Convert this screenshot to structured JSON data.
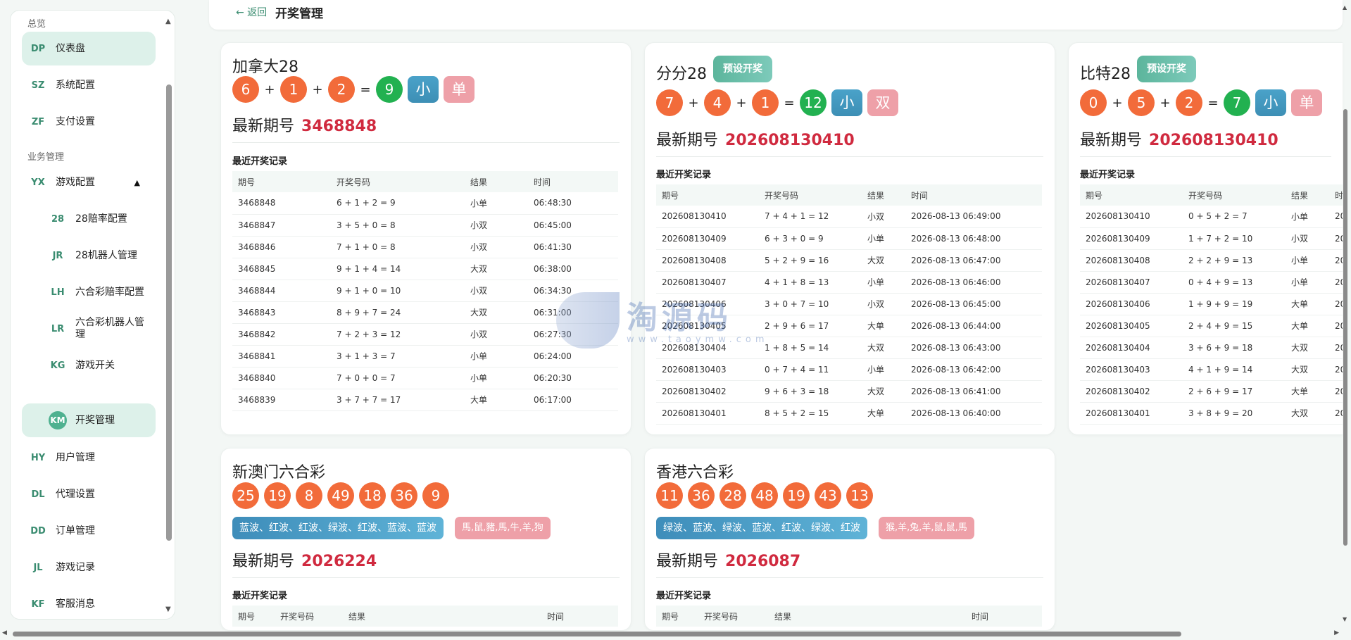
{
  "sidebar": {
    "sections": [
      "总览",
      "业务管理"
    ],
    "items": [
      {
        "abbr": "DP",
        "label": "仪表盘"
      },
      {
        "abbr": "SZ",
        "label": "系统配置"
      },
      {
        "abbr": "ZF",
        "label": "支付设置"
      },
      {
        "abbr": "YX",
        "label": "游戏配置"
      },
      {
        "abbr": "28",
        "label": "28赔率配置"
      },
      {
        "abbr": "JR",
        "label": "28机器人管理"
      },
      {
        "abbr": "LH",
        "label": "六合彩赔率配置"
      },
      {
        "abbr": "LR",
        "label": "六合彩机器人管\n理"
      },
      {
        "abbr": "KG",
        "label": "游戏开关"
      },
      {
        "abbr": "KM",
        "label": "开奖管理"
      },
      {
        "abbr": "HY",
        "label": "用户管理"
      },
      {
        "abbr": "DL",
        "label": "代理设置"
      },
      {
        "abbr": "DD",
        "label": "订单管理"
      },
      {
        "abbr": "JL",
        "label": "游戏记录"
      },
      {
        "abbr": "KF",
        "label": "客服消息"
      }
    ],
    "caret": "▲"
  },
  "header": {
    "back": "← 返回",
    "title": "开奖管理"
  },
  "common": {
    "preset": "预设开奖",
    "latest_label": "最新期号",
    "records_title": "最近开奖记录",
    "cols": [
      "期号",
      "开奖号码",
      "结果",
      "时间"
    ],
    "plus": "+",
    "eq": "="
  },
  "cards": {
    "ca28": {
      "name": "加拿大28",
      "balls": [
        "6",
        "1",
        "2"
      ],
      "sum": "9",
      "size": "小",
      "parity": "单",
      "latest": "3468848",
      "rows": [
        [
          "3468848",
          "6 + 1 + 2 = 9",
          "小单",
          "06:48:30"
        ],
        [
          "3468847",
          "3 + 5 + 0 = 8",
          "小双",
          "06:45:00"
        ],
        [
          "3468846",
          "7 + 1 + 0 = 8",
          "小双",
          "06:41:30"
        ],
        [
          "3468845",
          "9 + 1 + 4 = 14",
          "大双",
          "06:38:00"
        ],
        [
          "3468844",
          "9 + 1 + 0 = 10",
          "小双",
          "06:34:30"
        ],
        [
          "3468843",
          "8 + 9 + 7 = 24",
          "大双",
          "06:31:00"
        ],
        [
          "3468842",
          "7 + 2 + 3 = 12",
          "小双",
          "06:27:30"
        ],
        [
          "3468841",
          "3 + 1 + 3 = 7",
          "小单",
          "06:24:00"
        ],
        [
          "3468840",
          "7 + 0 + 0 = 7",
          "小单",
          "06:20:30"
        ],
        [
          "3468839",
          "3 + 7 + 7 = 17",
          "大单",
          "06:17:00"
        ]
      ]
    },
    "ff28": {
      "name": "分分28",
      "balls": [
        "7",
        "4",
        "1"
      ],
      "sum": "12",
      "size": "小",
      "parity": "双",
      "latest": "202608130410",
      "rows": [
        [
          "202608130410",
          "7 + 4 + 1 = 12",
          "小双",
          "2026-08-13 06:49:00"
        ],
        [
          "202608130409",
          "6 + 3 + 0 = 9",
          "小单",
          "2026-08-13 06:48:00"
        ],
        [
          "202608130408",
          "5 + 2 + 9 = 16",
          "大双",
          "2026-08-13 06:47:00"
        ],
        [
          "202608130407",
          "4 + 1 + 8 = 13",
          "小单",
          "2026-08-13 06:46:00"
        ],
        [
          "202608130406",
          "3 + 0 + 7 = 10",
          "小双",
          "2026-08-13 06:45:00"
        ],
        [
          "202608130405",
          "2 + 9 + 6 = 17",
          "大单",
          "2026-08-13 06:44:00"
        ],
        [
          "202608130404",
          "1 + 8 + 5 = 14",
          "大双",
          "2026-08-13 06:43:00"
        ],
        [
          "202608130403",
          "0 + 7 + 4 = 11",
          "小单",
          "2026-08-13 06:42:00"
        ],
        [
          "202608130402",
          "9 + 6 + 3 = 18",
          "大双",
          "2026-08-13 06:41:00"
        ],
        [
          "202608130401",
          "8 + 5 + 2 = 15",
          "大单",
          "2026-08-13 06:40:00"
        ]
      ]
    },
    "bt28": {
      "name": "比特28",
      "balls": [
        "0",
        "5",
        "2"
      ],
      "sum": "7",
      "size": "小",
      "parity": "单",
      "latest": "202608130410",
      "rows": [
        [
          "202608130410",
          "0 + 5 + 2 = 7",
          "小单",
          "20"
        ],
        [
          "202608130409",
          "1 + 7 + 2 = 10",
          "小双",
          "20"
        ],
        [
          "202608130408",
          "2 + 2 + 9 = 13",
          "小单",
          "20"
        ],
        [
          "202608130407",
          "0 + 4 + 9 = 13",
          "小单",
          "20"
        ],
        [
          "202608130406",
          "1 + 9 + 9 = 19",
          "大单",
          "20"
        ],
        [
          "202608130405",
          "2 + 4 + 9 = 15",
          "大单",
          "20"
        ],
        [
          "202608130404",
          "3 + 6 + 9 = 18",
          "大双",
          "20"
        ],
        [
          "202608130403",
          "4 + 1 + 9 = 14",
          "大双",
          "20"
        ],
        [
          "202608130402",
          "2 + 6 + 9 = 17",
          "大单",
          "20"
        ],
        [
          "202608130401",
          "3 + 8 + 9 = 20",
          "大双",
          "20"
        ]
      ],
      "time_col": "时"
    },
    "macau": {
      "name": "新澳门六合彩",
      "balls": [
        "25",
        "19",
        "8",
        "49",
        "18",
        "36",
        "9"
      ],
      "waves": "蓝波、红波、红波、绿波、红波、蓝波、蓝波",
      "zodiac": "馬,鼠,豬,馬,牛,羊,狗",
      "latest": "2026224",
      "cols": [
        "期号",
        "开奖号码",
        "结果",
        "时间"
      ]
    },
    "hk": {
      "name": "香港六合彩",
      "balls": [
        "11",
        "36",
        "28",
        "48",
        "19",
        "43",
        "13"
      ],
      "waves": "绿波、蓝波、绿波、蓝波、红波、绿波、红波",
      "zodiac": "猴,羊,兔,羊,鼠,鼠,馬",
      "latest": "2026087",
      "cols": [
        "期号",
        "开奖号码",
        "结果",
        "时间"
      ]
    }
  },
  "watermark": {
    "cn": "淘源码",
    "en": "www.taoymw.com"
  },
  "colors": {
    "accent": "#3a8c70",
    "ball": "#f26b3a",
    "sum": "#22b150",
    "period": "#d02a3f"
  }
}
